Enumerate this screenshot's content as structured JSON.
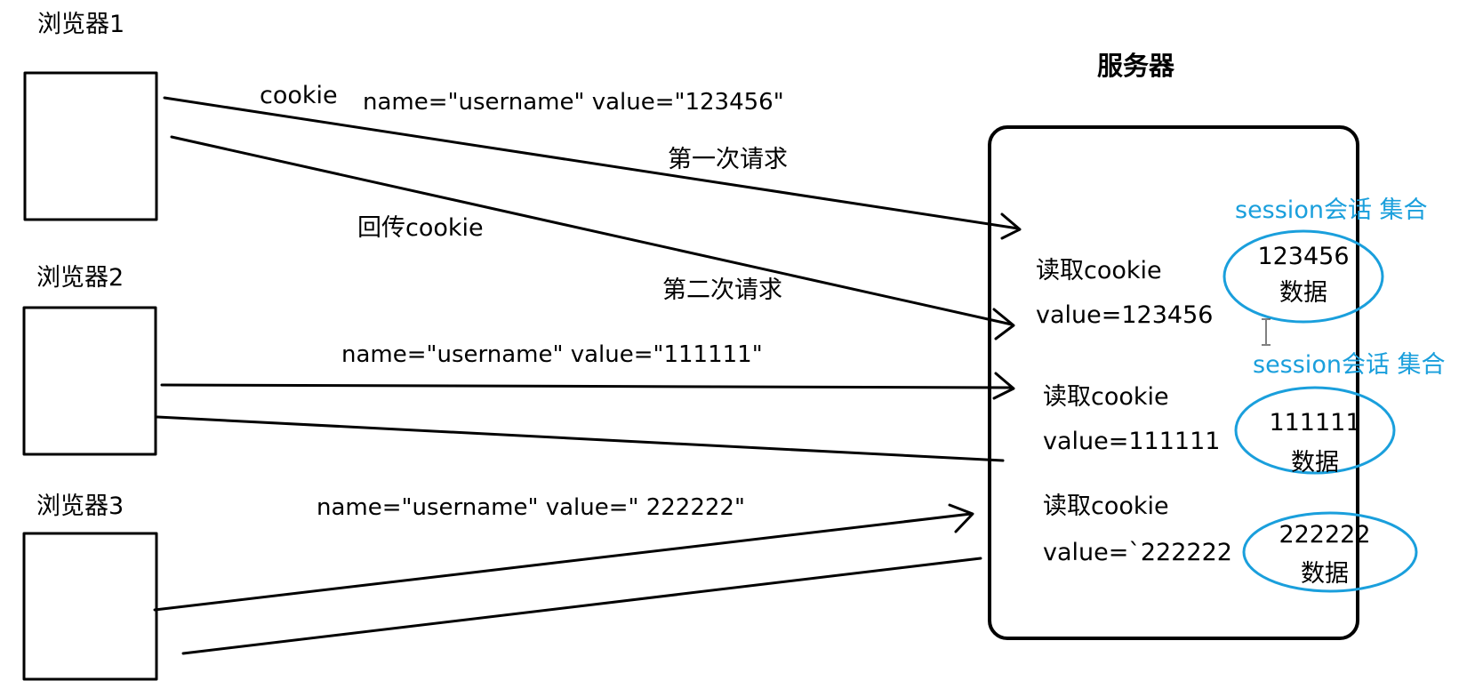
{
  "colors": {
    "ink": "#000000",
    "session": "#1a9fdc",
    "background": "#ffffff"
  },
  "browsers": [
    {
      "label": "浏览器1"
    },
    {
      "label": "浏览器2"
    },
    {
      "label": "浏览器3"
    }
  ],
  "server": {
    "title": "服务器",
    "reads": [
      {
        "label": "读取cookie",
        "value": "value=123456"
      },
      {
        "label": "读取cookie",
        "value": "value=111111"
      },
      {
        "label": "读取cookie",
        "value": "value=`222222"
      }
    ],
    "sessions": [
      {
        "title": "session会话 集合",
        "id": "123456",
        "data": "数据"
      },
      {
        "title": "session会话 集合",
        "id": "111111",
        "data": "数据"
      },
      {
        "id": "222222",
        "data": "数据"
      }
    ]
  },
  "edges": {
    "cookie_word": "cookie",
    "b1_cookie": "name=\"username\"  value=\"123456\"",
    "first_request": "第一次请求",
    "return_cookie": "回传cookie",
    "second_request": "第二次请求",
    "b2_cookie": "name=\"username\"  value=\"111111\"",
    "b3_cookie": "name=\"username\"  value=\" 222222\""
  }
}
